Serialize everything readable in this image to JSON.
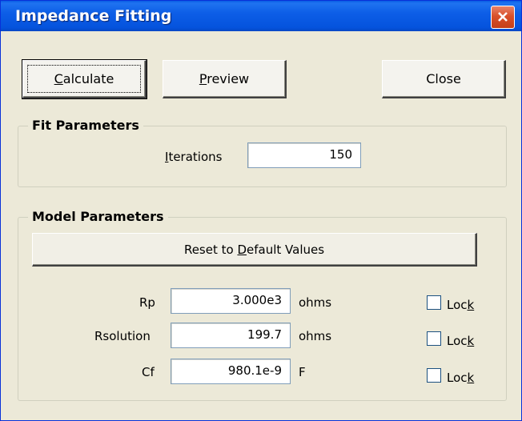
{
  "window": {
    "title": "Impedance Fitting",
    "close_icon": "close-x-icon"
  },
  "toolbar": {
    "calculate_pre": "",
    "calculate_key": "C",
    "calculate_post": "alculate",
    "preview_pre": "",
    "preview_key": "P",
    "preview_post": "review",
    "close_label": "Close"
  },
  "fit_parameters": {
    "title": "Fit Parameters",
    "iterations_key": "I",
    "iterations_post": "terations",
    "iterations_value": "150"
  },
  "model_parameters": {
    "title": "Model Parameters",
    "reset_pre": "Reset to ",
    "reset_key": "D",
    "reset_post": "efault Values",
    "rows": [
      {
        "label": "Rp",
        "value": "3.000e3",
        "unit": "ohms",
        "lock_pre": "Loc",
        "lock_key": "k",
        "locked": false
      },
      {
        "label": "Rsolution",
        "value": "199.7",
        "unit": "ohms",
        "lock_pre": "Loc",
        "lock_key": "k",
        "locked": false
      },
      {
        "label": "Cf",
        "value": "980.1e-9",
        "unit": "F",
        "lock_pre": "Loc",
        "lock_key": "k",
        "locked": false
      }
    ]
  },
  "colors": {
    "titlebar": "#0553dd",
    "dialog_bg": "#ece9d8",
    "close_button": "#d9502a"
  }
}
